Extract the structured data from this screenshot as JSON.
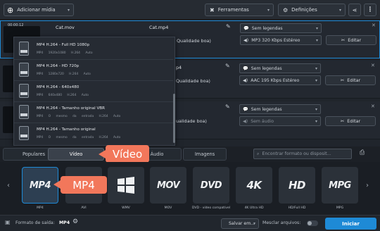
{
  "toolbar": {
    "add_media": "Adicionar mídia",
    "tools": "Ferramentas",
    "settings": "Definições"
  },
  "files": [
    {
      "time": "00:00:12",
      "source": "Cat.mov",
      "output": "Cat.mp4",
      "quality": "Qualidade boa)",
      "subtitles": "Sem legendas",
      "audio": "MP3 320 Kbps Estéreo",
      "edit": "Editar"
    },
    {
      "output": "p4",
      "quality": "Qualidade boa)",
      "subtitles": "Sem legendas",
      "audio": "AAC 195 Kbps Estéreo",
      "edit": "Editar"
    },
    {
      "output": "",
      "quality": "ualidade boa)",
      "subtitles": "Sem legendas",
      "audio": "Sem áudio",
      "edit": "Editar"
    }
  ],
  "presets": [
    {
      "title": "MP4 H.264 - Full HD 1080p",
      "sub": "MP4   1920x1080   H.264   Auto"
    },
    {
      "title": "MP4 H.264 - HD 720p",
      "sub": "MP4   1280x720   H.264   Auto"
    },
    {
      "title": "MP4 H.264 - 640x480",
      "sub": "MP4   640x480   H.264   Auto"
    },
    {
      "title": "MP4 H.264 - Tamanho original VBR",
      "sub": "MP4   O mesmo da entrada   H.264   Auto"
    },
    {
      "title": "MP4 H.264 - Tamanho original",
      "sub": "MP4   O mesmo da entrada   H.264   Auto"
    }
  ],
  "tabs": {
    "popular": "Populares",
    "video": "Vídeo",
    "audio": "Áudio",
    "images": "Imagens"
  },
  "search": {
    "placeholder": "Encontrar formato ou disposit..."
  },
  "callouts": {
    "video": "Vídeo",
    "mp4": "MP4"
  },
  "formats": [
    {
      "name": "MP4",
      "icon": "MP4"
    },
    {
      "name": "AVI",
      "icon": "AVI"
    },
    {
      "name": "WMV",
      "icon": "WMV"
    },
    {
      "name": "MOV",
      "icon": "MOV"
    },
    {
      "name": "DVD - vídeo compatível",
      "icon": "DVD"
    },
    {
      "name": "4K Ultra HD",
      "icon": "4K"
    },
    {
      "name": "HD/Full HD",
      "icon": "HD"
    },
    {
      "name": "MPG",
      "icon": "MPG"
    }
  ],
  "bottom": {
    "output_format_label": "Formato de saída:",
    "output_format_value": "MP4",
    "save_in": "Salvar em...",
    "merge_files": "Mesclar arquivos:",
    "convert": "Iniciar"
  },
  "colors": {
    "accent": "#1e8ad6",
    "callout": "#f2775b"
  }
}
